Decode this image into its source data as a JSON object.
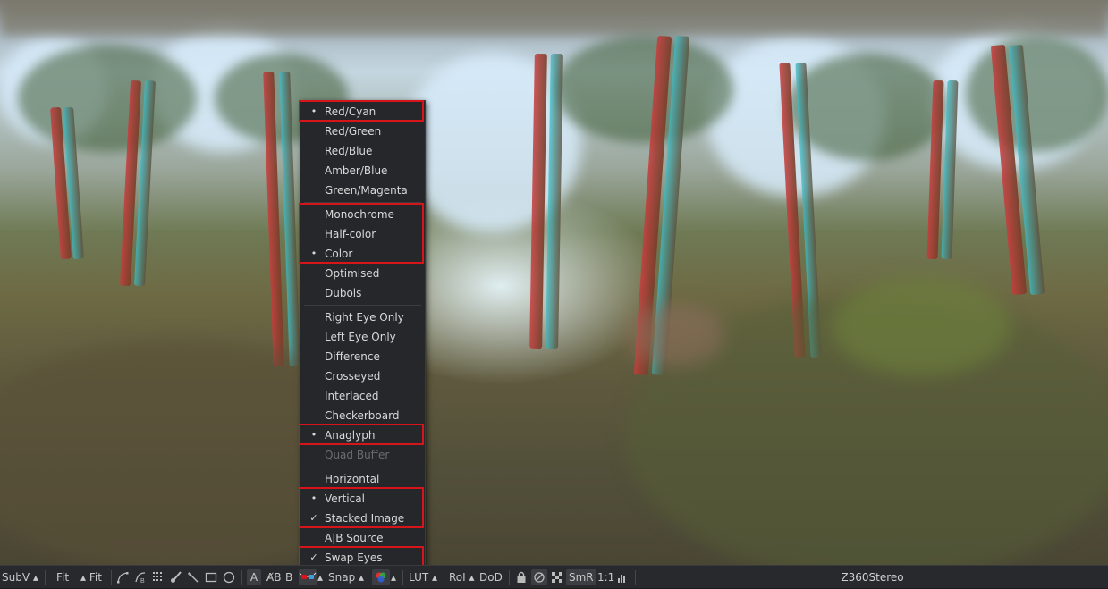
{
  "menu": {
    "items": [
      {
        "label": "Red/Cyan",
        "mark": "•",
        "disabled": false
      },
      {
        "label": "Red/Green",
        "mark": "",
        "disabled": false
      },
      {
        "label": "Red/Blue",
        "mark": "",
        "disabled": false
      },
      {
        "label": "Amber/Blue",
        "mark": "",
        "disabled": false
      },
      {
        "label": "Green/Magenta",
        "mark": "",
        "disabled": false
      },
      {
        "label": "Monochrome",
        "mark": "",
        "disabled": false
      },
      {
        "label": "Half-color",
        "mark": "",
        "disabled": false
      },
      {
        "label": "Color",
        "mark": "•",
        "disabled": false
      },
      {
        "label": "Optimised",
        "mark": "",
        "disabled": false
      },
      {
        "label": "Dubois",
        "mark": "",
        "disabled": false
      },
      {
        "label": "Right Eye Only",
        "mark": "",
        "disabled": false
      },
      {
        "label": "Left Eye Only",
        "mark": "",
        "disabled": false
      },
      {
        "label": "Difference",
        "mark": "",
        "disabled": false
      },
      {
        "label": "Crosseyed",
        "mark": "",
        "disabled": false
      },
      {
        "label": "Interlaced",
        "mark": "",
        "disabled": false
      },
      {
        "label": "Checkerboard",
        "mark": "",
        "disabled": false
      },
      {
        "label": "Anaglyph",
        "mark": "•",
        "disabled": false
      },
      {
        "label": "Quad Buffer",
        "mark": "",
        "disabled": true
      },
      {
        "label": "Horizontal",
        "mark": "",
        "disabled": false
      },
      {
        "label": "Vertical",
        "mark": "•",
        "disabled": false
      },
      {
        "label": "Stacked Image",
        "mark": "✓",
        "disabled": false
      },
      {
        "label": "A|B Source",
        "mark": "",
        "disabled": false
      },
      {
        "label": "Swap Eyes",
        "mark": "✓",
        "disabled": false
      }
    ]
  },
  "toolbar": {
    "subv": "SubV",
    "fit1": "Fit",
    "fit2": "Fit",
    "a": "A",
    "ab": "A̸B",
    "b": "B",
    "snap": "Snap",
    "lut": "LUT",
    "roi": "RoI",
    "dod": "DoD",
    "smr": "SmR",
    "ratio": "1:1",
    "view_name": "Z360Stereo"
  },
  "colors": {
    "highlight": "#d8141b",
    "menu_bg": "#26272b",
    "toolbar_bg": "#28292d"
  }
}
